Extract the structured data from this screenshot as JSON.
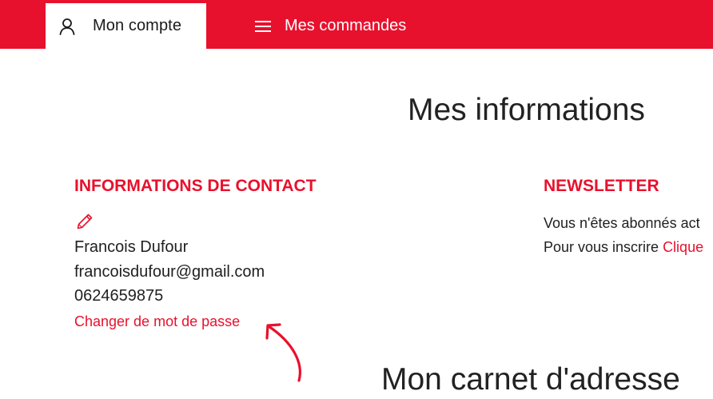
{
  "colors": {
    "accent": "#e8112d",
    "text": "#222222",
    "tab_active_bg": "#ffffff"
  },
  "nav": {
    "tabs": [
      {
        "label": "Mon compte",
        "icon": "user-icon",
        "active": true
      },
      {
        "label": "Mes commandes",
        "icon": "hamburger-menu-icon",
        "active": false
      }
    ]
  },
  "main": {
    "title": "Mes informations",
    "contact": {
      "heading": "INFORMATIONS DE CONTACT",
      "edit_icon": "pencil-icon",
      "name": "Francois Dufour",
      "email": "francoisdufour@gmail.com",
      "phone": "0624659875",
      "change_password_label": "Changer de mot de passe"
    },
    "newsletter": {
      "heading": "NEWSLETTER",
      "status_text": "Vous n'êtes abonnés act",
      "signup_prefix": "Pour vous inscrire ",
      "signup_link": "Clique"
    },
    "address_book_title": "Mon carnet d'adresse"
  },
  "annotation": {
    "arrow_icon": "curved-arrow-icon"
  }
}
